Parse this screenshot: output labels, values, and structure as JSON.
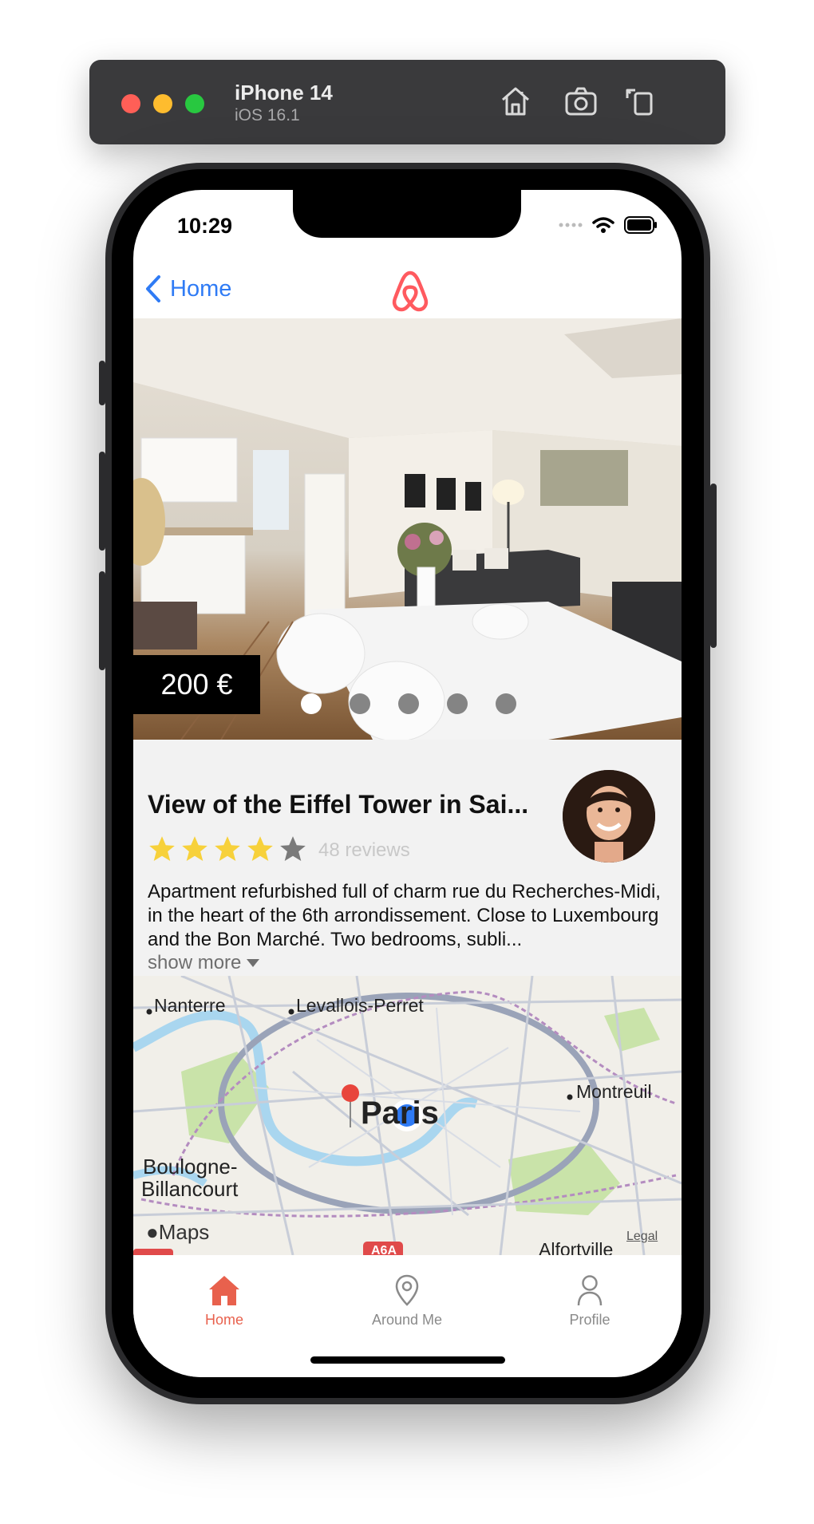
{
  "simulator": {
    "device_name": "iPhone 14",
    "os_version": "iOS 16.1",
    "home_icon": "home-icon",
    "screenshot_icon": "camera-icon",
    "rotate_icon": "rotate-icon"
  },
  "status_bar": {
    "time": "10:29"
  },
  "nav": {
    "back_label": "Home",
    "logo": "airbnb-logo-icon",
    "brand_color": "#ff5a5f"
  },
  "listing": {
    "price": "200 €",
    "photo_count": 5,
    "active_photo": 1,
    "title": "View of the Eiffel Tower in Sai...",
    "rating": 4,
    "max_rating": 5,
    "reviews": "48 reviews",
    "description": "Apartment refurbished full of charm rue du Recherches-Midi, in the heart of the 6th arrondissement. Close to Luxembourg and the Bon Marché. Two bedrooms, subli...",
    "show_more": "show more"
  },
  "map": {
    "labels": {
      "nanterre": "Nanterre",
      "levallois": "Levallois-Perret",
      "montreuil": "Montreuil",
      "paris": "Paris",
      "boulogne_1": "Boulogne-",
      "boulogne_2": "Billancourt",
      "alfortville": "Alfortville",
      "a6a": "A6A",
      "maps_logo": "Maps",
      "legal": "Legal"
    }
  },
  "tabs": [
    {
      "label": "Home",
      "icon": "house-icon",
      "active": true
    },
    {
      "label": "Around Me",
      "icon": "map-pin-icon",
      "active": false
    },
    {
      "label": "Profile",
      "icon": "person-icon",
      "active": false
    }
  ],
  "colors": {
    "accent": "#e8614d",
    "link": "#2f7bf5",
    "star": "#f7d13b"
  }
}
